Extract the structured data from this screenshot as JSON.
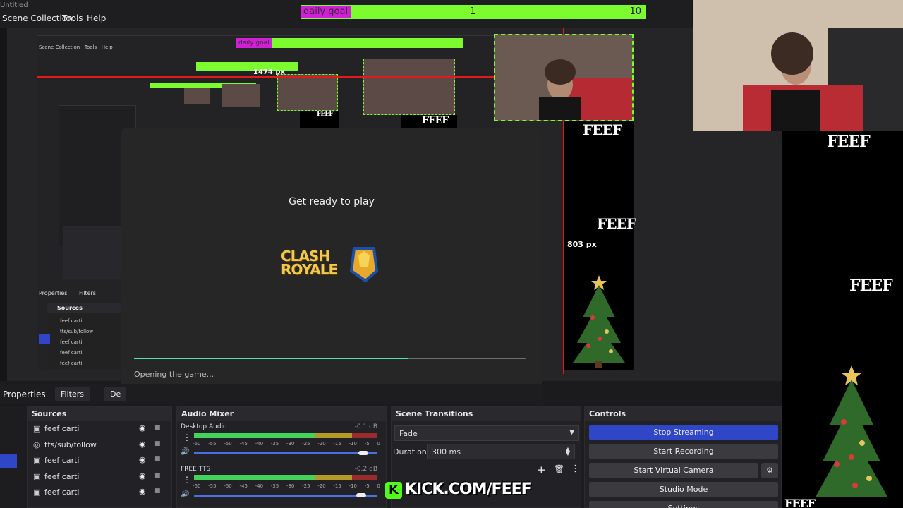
{
  "window": {
    "title": "Untitled"
  },
  "menu": {
    "items": [
      "Scene Collection",
      "Tools",
      "Help"
    ]
  },
  "goal": {
    "label": "daily goal",
    "current": "1",
    "target": "10",
    "fill_fraction": 1.0
  },
  "measure": {
    "width_label": "1474 px",
    "height_label": "803 px"
  },
  "overlay": {
    "watermark": "FEEF",
    "link": "KICK.COM/FEEF"
  },
  "dialog": {
    "title": "Get ready to play",
    "game_logo_text": "CLASH ROYALE",
    "status": "Opening the game...",
    "progress_fraction": 0.7
  },
  "tabs": {
    "properties": "Properties",
    "filters": "Filters",
    "defaults": "De"
  },
  "nested_sources": {
    "heading": "Sources",
    "items": [
      "feef carti",
      "tts/sub/follow",
      "feef carti",
      "feef carti",
      "feef carti"
    ],
    "tab_properties": "Properties",
    "tab_filters": "Filters"
  },
  "sources": {
    "title": "Sources",
    "items": [
      {
        "label": "feef carti",
        "icon": "image-icon"
      },
      {
        "label": "tts/sub/follow",
        "icon": "browser-icon"
      },
      {
        "label": "feef carti",
        "icon": "image-icon"
      },
      {
        "label": "feef carti",
        "icon": "image-icon"
      },
      {
        "label": "feef carti",
        "icon": "image-icon"
      }
    ]
  },
  "audio_mixer": {
    "title": "Audio Mixer",
    "channels": [
      {
        "name": "Desktop Audio",
        "level": "-0.1 dB",
        "volume_fraction": 0.95
      },
      {
        "name": "FREE TTS",
        "level": "-0.2 dB",
        "volume_fraction": 0.94
      }
    ],
    "scale": [
      "-60",
      "-55",
      "-50",
      "-45",
      "-40",
      "-35",
      "-30",
      "-25",
      "-20",
      "-15",
      "-10",
      "-5",
      "0"
    ]
  },
  "transitions": {
    "title": "Scene Transitions",
    "selected": "Fade",
    "duration_label": "Duration",
    "duration_value": "300 ms"
  },
  "controls": {
    "title": "Controls",
    "stop_streaming": "Stop Streaming",
    "start_recording": "Start Recording",
    "start_virtual_camera": "Start Virtual Camera",
    "studio_mode": "Studio Mode",
    "settings": "Settings"
  },
  "colors": {
    "accent": "#2f46c6",
    "goal_green": "#7cfb2e",
    "goal_magenta": "#d21ed7",
    "measure_red": "#e3191b"
  }
}
